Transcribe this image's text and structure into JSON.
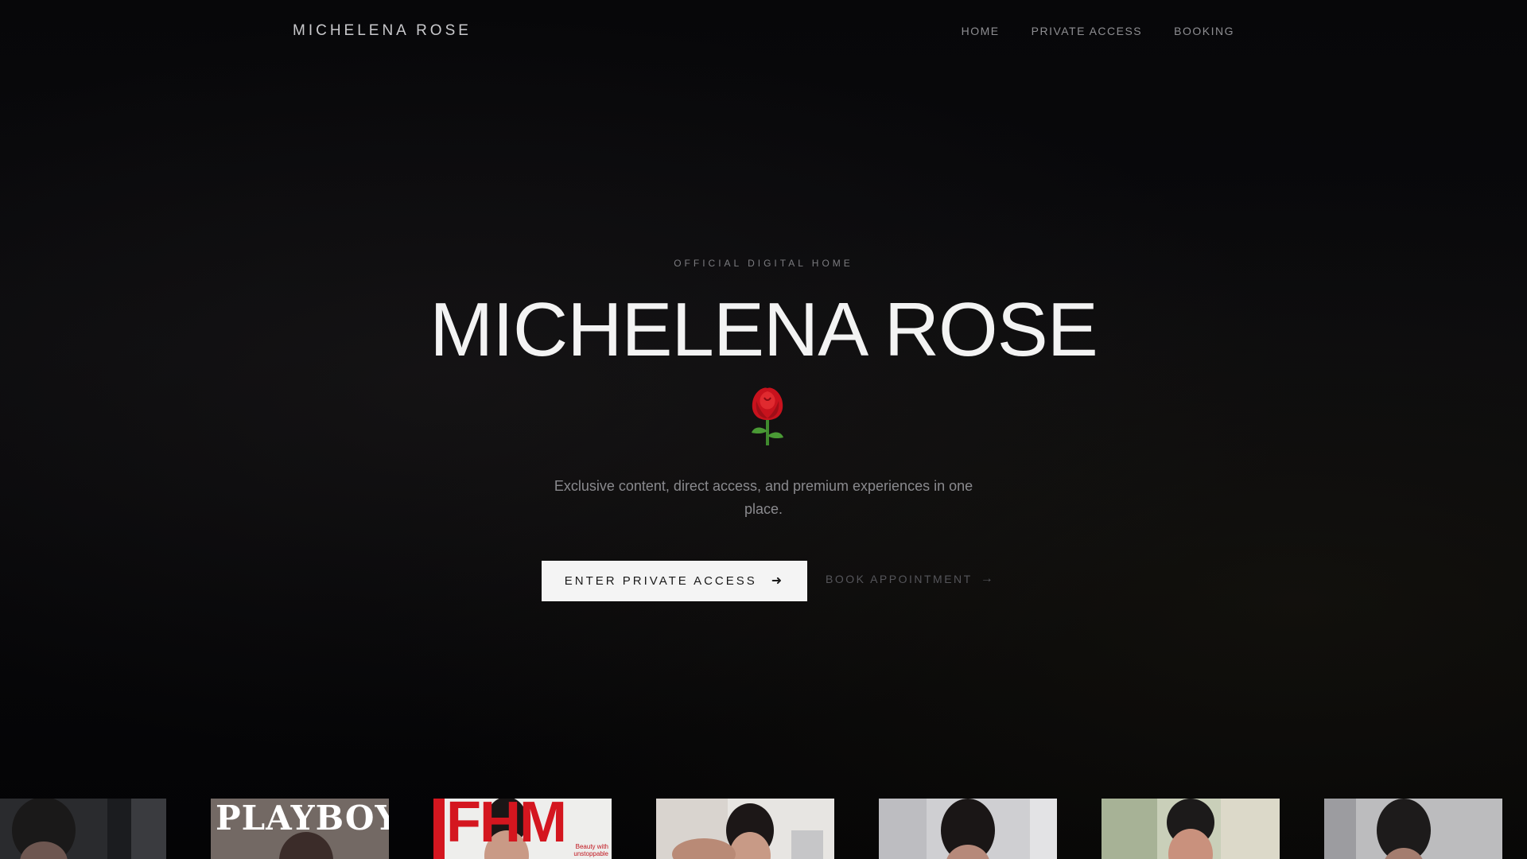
{
  "header": {
    "brand": "MICHELENA ROSE",
    "nav": [
      {
        "label": "HOME"
      },
      {
        "label": "PRIVATE ACCESS"
      },
      {
        "label": "BOOKING"
      }
    ]
  },
  "hero": {
    "eyebrow": "OFFICIAL DIGITAL HOME",
    "title": "MICHELENA ROSE",
    "emoji_icon": "rose-icon",
    "subtitle": "Exclusive content, direct access, and premium experiences in one place.",
    "primary_cta": "ENTER PRIVATE ACCESS",
    "secondary_cta": "BOOK APPOINTMENT"
  },
  "gallery": {
    "cover_1_title": "PLAYBOY",
    "cover_2_title": "FHM",
    "cover_2_tagline": "Beauty with unstoppable"
  },
  "colors": {
    "background": "#050507",
    "primary_button_bg": "#f4f4f4",
    "accent_red": "#d4161f"
  }
}
